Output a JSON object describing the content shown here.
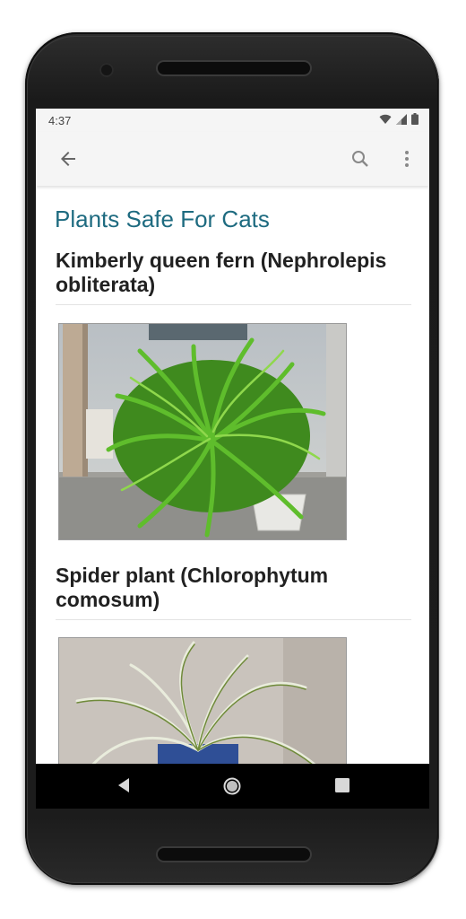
{
  "status_bar": {
    "time": "4:37",
    "icons": [
      "wifi-icon",
      "signal-icon",
      "battery-icon"
    ]
  },
  "app_bar": {
    "icons": [
      "back-arrow-icon",
      "search-icon",
      "more-vert-icon"
    ]
  },
  "page": {
    "title": "Plants Safe For Cats",
    "plants": [
      {
        "name": "Kimberly queen fern (Nephrolepis obliterata)"
      },
      {
        "name": "Spider plant (Chlorophytum comosum)"
      }
    ]
  },
  "nav_bar": {
    "icons": [
      "back-triangle-icon",
      "home-circle-icon",
      "recents-square-icon"
    ]
  },
  "colors": {
    "title": "#1e6b80",
    "appbar": "#f5f5f5",
    "nav": "#000000"
  }
}
